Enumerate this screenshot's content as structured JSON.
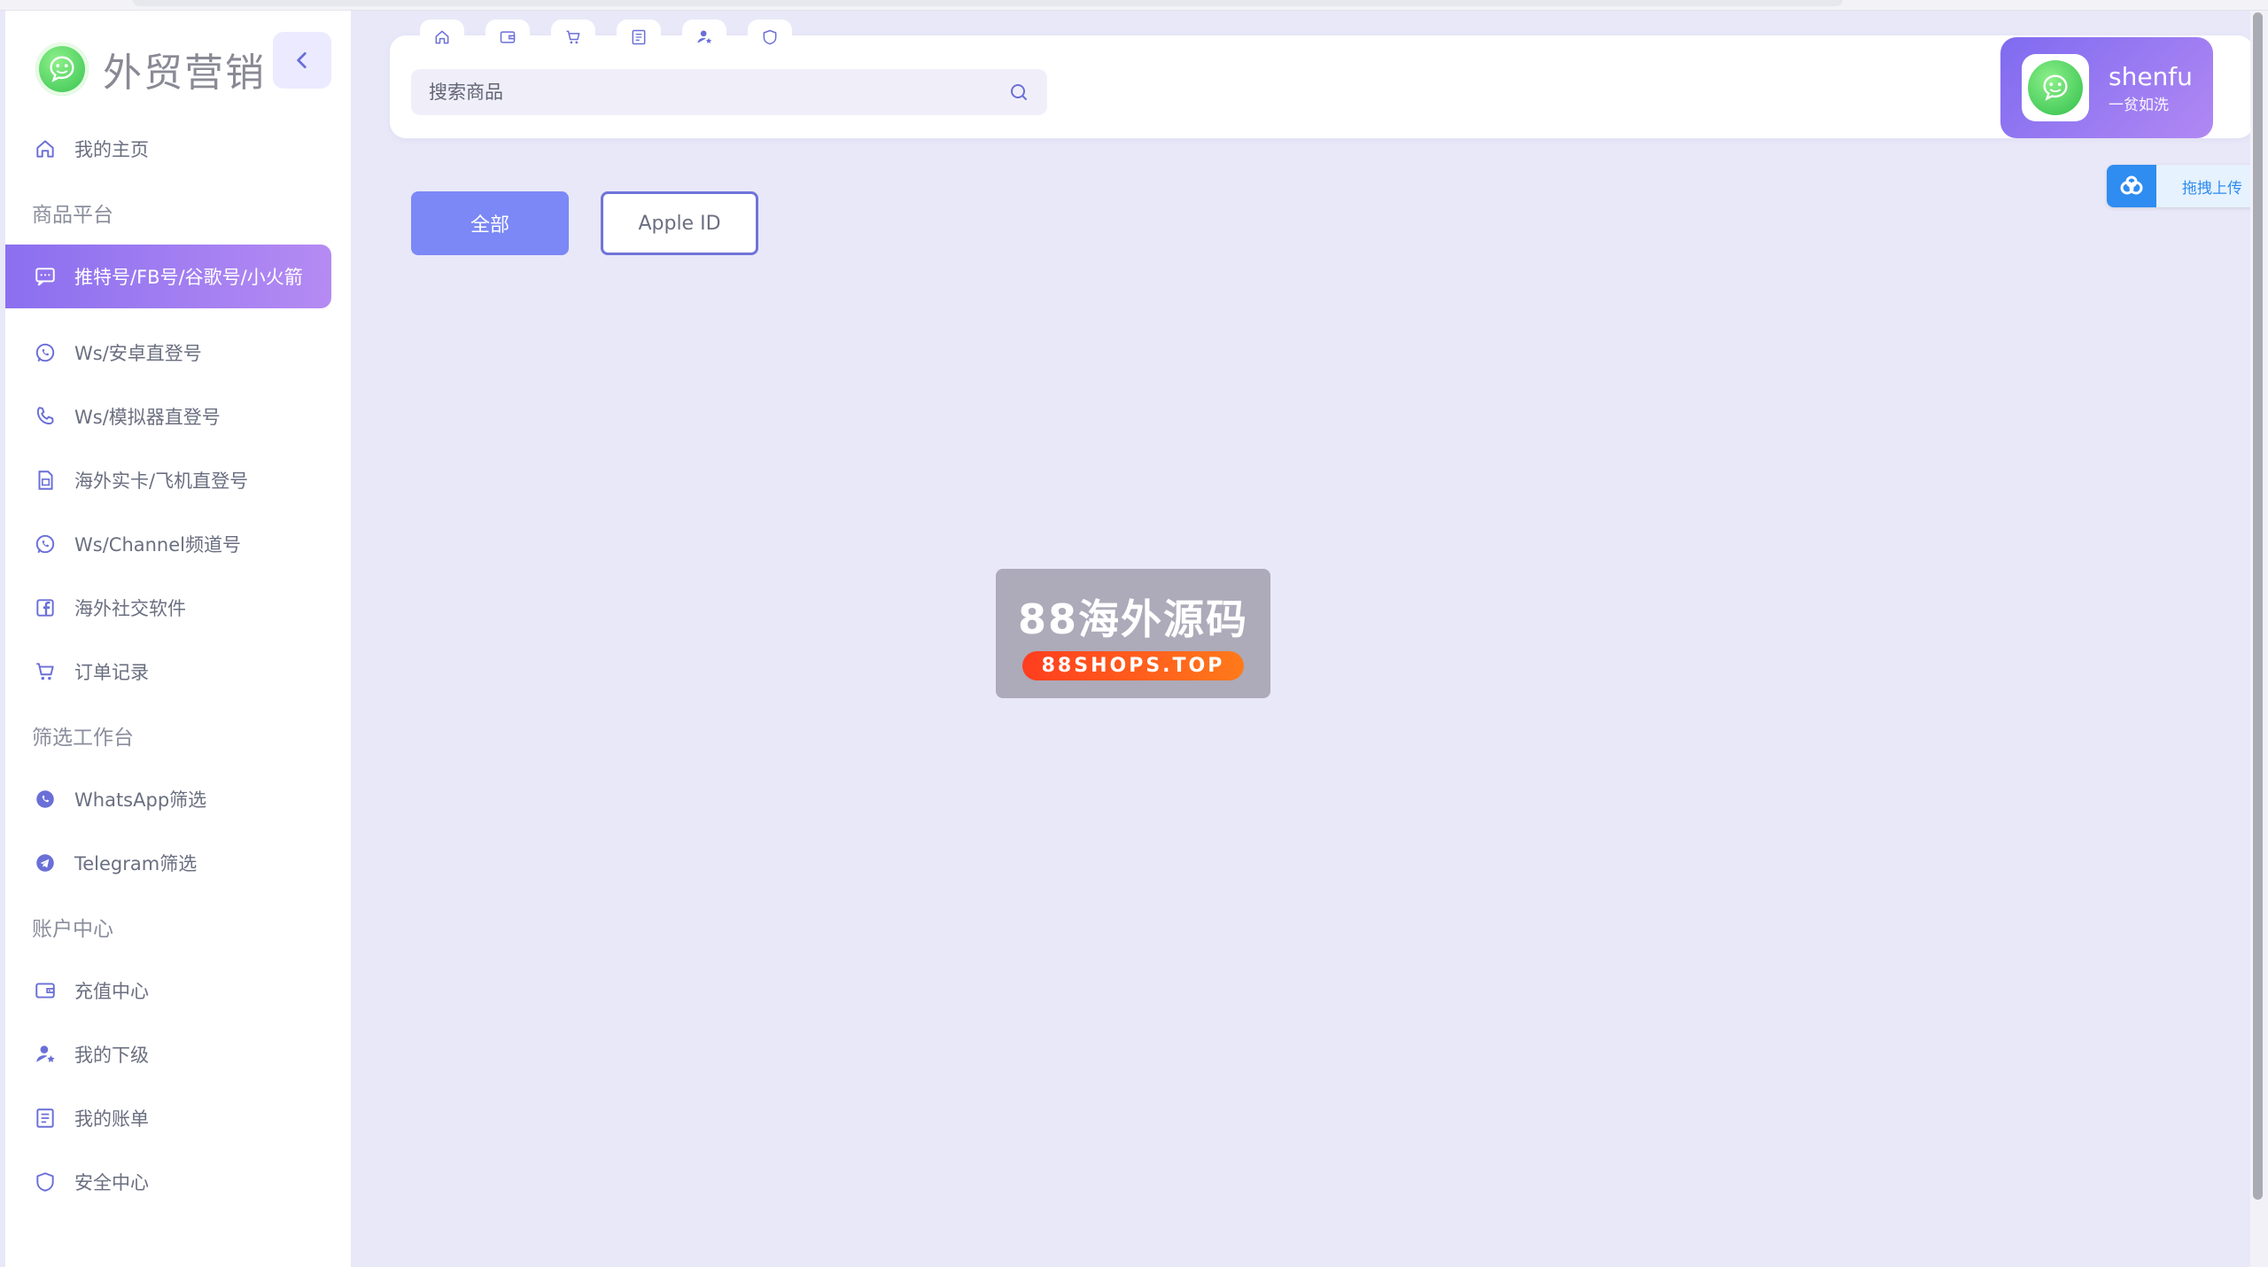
{
  "brand": {
    "name": "外贸营销",
    "logo_icon": "frog-logo-icon"
  },
  "sidebar": {
    "items": [
      {
        "type": "item",
        "label": "我的主页",
        "icon": "home-icon"
      },
      {
        "type": "section",
        "label": "商品平台"
      },
      {
        "type": "item",
        "label": "推特号/FB号/谷歌号/小火箭",
        "icon": "message-icon",
        "active": true
      },
      {
        "type": "item",
        "label": "Ws/安卓直登号",
        "icon": "whatsapp-icon"
      },
      {
        "type": "item",
        "label": "Ws/模拟器直登号",
        "icon": "phone-icon"
      },
      {
        "type": "item",
        "label": "海外实卡/飞机直登号",
        "icon": "sim-card-icon"
      },
      {
        "type": "item",
        "label": "Ws/Channel频道号",
        "icon": "whatsapp-icon"
      },
      {
        "type": "item",
        "label": "海外社交软件",
        "icon": "facebook-icon"
      },
      {
        "type": "item",
        "label": "订单记录",
        "icon": "cart-icon"
      },
      {
        "type": "section",
        "label": "筛选工作台"
      },
      {
        "type": "item",
        "label": "WhatsApp筛选",
        "icon": "whatsapp-filled-icon"
      },
      {
        "type": "item",
        "label": "Telegram筛选",
        "icon": "telegram-icon"
      },
      {
        "type": "section",
        "label": "账户中心"
      },
      {
        "type": "item",
        "label": "充值中心",
        "icon": "wallet-icon"
      },
      {
        "type": "item",
        "label": "我的下级",
        "icon": "user-star-icon"
      },
      {
        "type": "item",
        "label": "我的账单",
        "icon": "bill-icon"
      },
      {
        "type": "item",
        "label": "安全中心",
        "icon": "shield-icon"
      }
    ]
  },
  "quick_tabs": [
    "home-icon",
    "wallet-icon",
    "cart-icon",
    "bill-icon",
    "user-star-icon",
    "shield-icon"
  ],
  "search": {
    "placeholder": "搜索商品",
    "value": ""
  },
  "user": {
    "name": "shenfu",
    "motto": "一贫如洗"
  },
  "filters": [
    {
      "label": "全部",
      "selected": true
    },
    {
      "label": "Apple ID",
      "selected": false
    }
  ],
  "watermark": {
    "title": "88海外源码",
    "badge": "88SHOPS.TOP"
  },
  "upload_widget": {
    "label": "拖拽上传",
    "icon": "baidu-cloud-icon"
  },
  "colors": {
    "accent": "#8b6ff0",
    "accent_light": "#b58bf2",
    "primary_button": "#7b88f5",
    "background": "#e9e8f8",
    "icon": "#6a6fd8"
  }
}
